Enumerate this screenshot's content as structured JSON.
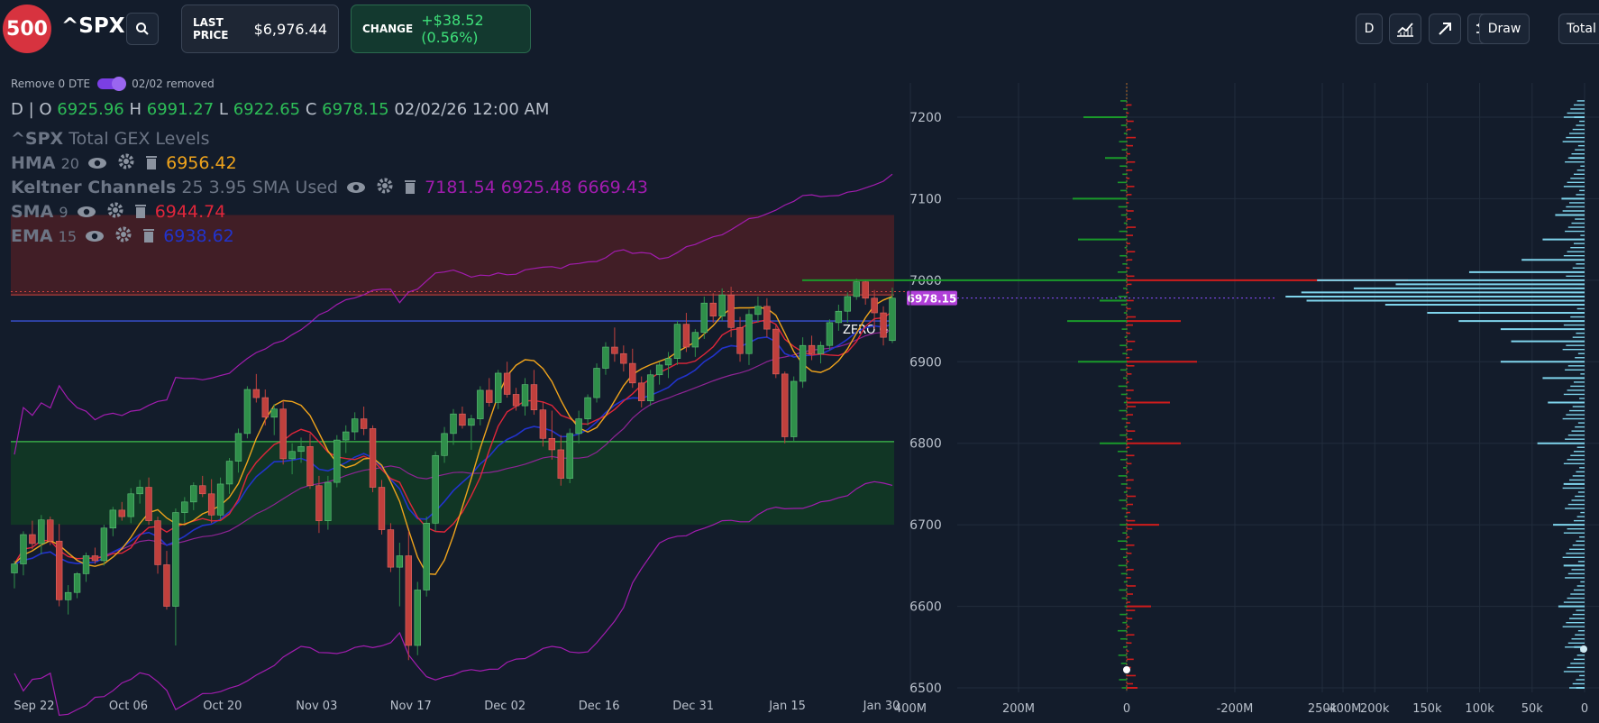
{
  "header": {
    "logo_text": "500",
    "ticker": "^SPX",
    "last_price_label": "LAST PRICE",
    "last_price_value": "$6,976.44",
    "change_label": "CHANGE",
    "change_value": "+$38.52 (0.56%)",
    "interval_button": "D",
    "draw_button": "Draw",
    "total_button": "Total"
  },
  "toolbar_icons": [
    "search-icon",
    "chart-icon",
    "arrow-icon",
    "settings-sliders-icon"
  ],
  "toggle": {
    "label": "Remove 0 DTE",
    "status": "02/02 removed",
    "enabled": true
  },
  "ohlc": {
    "interval": "D |",
    "o_label": "O",
    "o": "6925.96",
    "h_label": "H",
    "h": "6991.27",
    "l_label": "L",
    "l": "6922.65",
    "c_label": "C",
    "c": "6978.15",
    "datetime": "02/02/26 12:00 AM"
  },
  "indicators": {
    "gex": {
      "name": "^SPX",
      "suffix": "Total GEX Levels"
    },
    "hma": {
      "name": "HMA",
      "params": "20",
      "value": "6956.42",
      "color": "#f0a41c"
    },
    "keltner": {
      "name": "Keltner Channels",
      "params": "25 3.95 SMA Used",
      "values": "7181.54 6925.48 6669.43",
      "color": "#a21caf"
    },
    "sma": {
      "name": "SMA",
      "params": "9",
      "value": "6944.74",
      "color": "#e0263a"
    },
    "ema": {
      "name": "EMA",
      "params": "15",
      "value": "6938.62",
      "color": "#2233cc"
    }
  },
  "colors": {
    "up": "#2f8f4a",
    "down": "#c0403d",
    "background": "#131c2b",
    "price_tag": "#b03fd8",
    "zero_gamma_line": "#3a52d8",
    "gex_pos": "#1a9a2a",
    "gex_neg": "#d01c1c",
    "volume": "#7fd4ec"
  },
  "chart_data": [
    {
      "type": "candlestick",
      "y_range": [
        6500,
        7230
      ],
      "x_tick_labels": [
        "Sep 22",
        "Oct 06",
        "Oct 20",
        "Nov 03",
        "Nov 17",
        "Dec 02",
        "Dec 16",
        "Dec 31",
        "Jan 15",
        "Jan 30"
      ],
      "price_tag": "6978.15",
      "annotations": {
        "zero_gamma": {
          "label": "ZERO G",
          "value": 6950
        }
      },
      "zones": [
        {
          "name": "resistance",
          "from": 6982,
          "to": 7080,
          "color": "#4a1e26"
        },
        {
          "name": "support",
          "from": 6700,
          "to": 6802,
          "color": "#123b24"
        }
      ],
      "candles": [
        [
          6641,
          6656,
          6622,
          6652
        ],
        [
          6652,
          6692,
          6638,
          6688
        ],
        [
          6688,
          6705,
          6670,
          6677
        ],
        [
          6677,
          6712,
          6664,
          6706
        ],
        [
          6706,
          6710,
          6675,
          6680
        ],
        [
          6680,
          6701,
          6600,
          6608
        ],
        [
          6608,
          6626,
          6590,
          6617
        ],
        [
          6617,
          6642,
          6610,
          6640
        ],
        [
          6640,
          6666,
          6630,
          6662
        ],
        [
          6662,
          6672,
          6652,
          6656
        ],
        [
          6656,
          6700,
          6650,
          6696
        ],
        [
          6696,
          6722,
          6686,
          6718
        ],
        [
          6718,
          6728,
          6705,
          6710
        ],
        [
          6710,
          6745,
          6702,
          6738
        ],
        [
          6738,
          6755,
          6726,
          6746
        ],
        [
          6746,
          6758,
          6700,
          6705
        ],
        [
          6705,
          6710,
          6640,
          6651
        ],
        [
          6651,
          6668,
          6596,
          6600
        ],
        [
          6600,
          6720,
          6552,
          6715
        ],
        [
          6715,
          6734,
          6702,
          6728
        ],
        [
          6728,
          6752,
          6718,
          6748
        ],
        [
          6748,
          6760,
          6734,
          6738
        ],
        [
          6738,
          6756,
          6702,
          6712
        ],
        [
          6712,
          6758,
          6706,
          6750
        ],
        [
          6750,
          6782,
          6738,
          6778
        ],
        [
          6778,
          6818,
          6764,
          6812
        ],
        [
          6812,
          6870,
          6806,
          6866
        ],
        [
          6866,
          6885,
          6850,
          6856
        ],
        [
          6856,
          6866,
          6822,
          6832
        ],
        [
          6832,
          6848,
          6810,
          6842
        ],
        [
          6842,
          6852,
          6774,
          6781
        ],
        [
          6781,
          6800,
          6762,
          6790
        ],
        [
          6790,
          6807,
          6776,
          6796
        ],
        [
          6796,
          6812,
          6744,
          6748
        ],
        [
          6748,
          6760,
          6690,
          6705
        ],
        [
          6705,
          6760,
          6694,
          6752
        ],
        [
          6752,
          6810,
          6746,
          6804
        ],
        [
          6804,
          6822,
          6788,
          6814
        ],
        [
          6814,
          6838,
          6804,
          6830
        ],
        [
          6830,
          6845,
          6810,
          6818
        ],
        [
          6818,
          6822,
          6740,
          6746
        ],
        [
          6746,
          6755,
          6688,
          6694
        ],
        [
          6694,
          6702,
          6642,
          6648
        ],
        [
          6648,
          6678,
          6600,
          6662
        ],
        [
          6662,
          6692,
          6534,
          6552
        ],
        [
          6552,
          6630,
          6540,
          6620
        ],
        [
          6620,
          6710,
          6612,
          6702
        ],
        [
          6702,
          6790,
          6692,
          6785
        ],
        [
          6785,
          6820,
          6776,
          6812
        ],
        [
          6812,
          6842,
          6798,
          6836
        ],
        [
          6836,
          6845,
          6818,
          6822
        ],
        [
          6822,
          6835,
          6792,
          6830
        ],
        [
          6830,
          6870,
          6822,
          6865
        ],
        [
          6865,
          6880,
          6845,
          6850
        ],
        [
          6850,
          6890,
          6842,
          6886
        ],
        [
          6886,
          6900,
          6856,
          6860
        ],
        [
          6860,
          6868,
          6840,
          6846
        ],
        [
          6846,
          6880,
          6834,
          6872
        ],
        [
          6872,
          6890,
          6835,
          6841
        ],
        [
          6841,
          6850,
          6796,
          6806
        ],
        [
          6806,
          6840,
          6780,
          6792
        ],
        [
          6792,
          6810,
          6748,
          6757
        ],
        [
          6757,
          6818,
          6751,
          6812
        ],
        [
          6812,
          6840,
          6800,
          6830
        ],
        [
          6830,
          6860,
          6822,
          6856
        ],
        [
          6856,
          6898,
          6850,
          6892
        ],
        [
          6892,
          6924,
          6884,
          6918
        ],
        [
          6918,
          6942,
          6900,
          6910
        ],
        [
          6910,
          6920,
          6888,
          6898
        ],
        [
          6898,
          6916,
          6868,
          6874
        ],
        [
          6874,
          6882,
          6844,
          6852
        ],
        [
          6852,
          6890,
          6846,
          6884
        ],
        [
          6884,
          6900,
          6872,
          6896
        ],
        [
          6896,
          6912,
          6880,
          6904
        ],
        [
          6904,
          6950,
          6896,
          6946
        ],
        [
          6946,
          6960,
          6912,
          6918
        ],
        [
          6918,
          6940,
          6906,
          6936
        ],
        [
          6936,
          6980,
          6928,
          6972
        ],
        [
          6972,
          6984,
          6948,
          6956
        ],
        [
          6956,
          6990,
          6950,
          6982
        ],
        [
          6982,
          6992,
          6930,
          6942
        ],
        [
          6942,
          6955,
          6900,
          6910
        ],
        [
          6910,
          6964,
          6896,
          6958
        ],
        [
          6958,
          6980,
          6948,
          6968
        ],
        [
          6968,
          6978,
          6930,
          6940
        ],
        [
          6940,
          6945,
          6880,
          6885
        ],
        [
          6885,
          6888,
          6800,
          6808
        ],
        [
          6808,
          6882,
          6802,
          6876
        ],
        [
          6876,
          6930,
          6868,
          6920
        ],
        [
          6920,
          6932,
          6902,
          6910
        ],
        [
          6910,
          6925,
          6898,
          6920
        ],
        [
          6920,
          6952,
          6914,
          6948
        ],
        [
          6948,
          6970,
          6938,
          6962
        ],
        [
          6962,
          6985,
          6948,
          6980
        ],
        [
          6980,
          7002,
          6976,
          6998
        ],
        [
          6998,
          7000,
          6970,
          6978
        ],
        [
          6978,
          6988,
          6940,
          6960
        ],
        [
          6960,
          6968,
          6920,
          6930
        ],
        [
          6926,
          6991,
          6923,
          6978
        ]
      ]
    },
    {
      "type": "bar",
      "name": "GEX by strike",
      "x_tick_labels": [
        "400M",
        "200M",
        "0",
        "-200M",
        "-400M"
      ],
      "y_tick_labels": [
        "7200",
        "7100",
        "7000",
        "6900",
        "6800",
        "6700",
        "6600",
        "6500"
      ],
      "levels": [
        {
          "strike": 7200,
          "value": 80
        },
        {
          "strike": 7150,
          "value": 40
        },
        {
          "strike": 7100,
          "value": 100
        },
        {
          "strike": 7050,
          "value": 90
        },
        {
          "strike": 7000,
          "value": 600
        },
        {
          "strike": 7000,
          "value": -520
        },
        {
          "strike": 6975,
          "value": 50
        },
        {
          "strike": 6950,
          "value": 110
        },
        {
          "strike": 6950,
          "value": -100
        },
        {
          "strike": 6900,
          "value": 90
        },
        {
          "strike": 6900,
          "value": -130
        },
        {
          "strike": 6850,
          "value": -80
        },
        {
          "strike": 6800,
          "value": 50
        },
        {
          "strike": 6800,
          "value": -100
        },
        {
          "strike": 6700,
          "value": -60
        },
        {
          "strike": 6600,
          "value": -45
        },
        {
          "strike": 6500,
          "value": -20
        }
      ],
      "marker": "0"
    },
    {
      "type": "bar",
      "name": "Total by strike",
      "x_tick_labels": [
        "250k",
        "200k",
        "150k",
        "100k",
        "50k",
        "0"
      ],
      "levels": [
        {
          "strike": 7200,
          "value": 10
        },
        {
          "strike": 7150,
          "value": 14
        },
        {
          "strike": 7100,
          "value": 22
        },
        {
          "strike": 7080,
          "value": 28
        },
        {
          "strike": 7050,
          "value": 40
        },
        {
          "strike": 7025,
          "value": 60
        },
        {
          "strike": 7010,
          "value": 110
        },
        {
          "strike": 7000,
          "value": 255
        },
        {
          "strike": 6995,
          "value": 180
        },
        {
          "strike": 6990,
          "value": 220
        },
        {
          "strike": 6985,
          "value": 270
        },
        {
          "strike": 6980,
          "value": 285
        },
        {
          "strike": 6975,
          "value": 265
        },
        {
          "strike": 6970,
          "value": 190
        },
        {
          "strike": 6960,
          "value": 150
        },
        {
          "strike": 6950,
          "value": 120
        },
        {
          "strike": 6940,
          "value": 80
        },
        {
          "strike": 6925,
          "value": 70
        },
        {
          "strike": 6900,
          "value": 80
        },
        {
          "strike": 6880,
          "value": 40
        },
        {
          "strike": 6850,
          "value": 35
        },
        {
          "strike": 6800,
          "value": 45
        },
        {
          "strike": 6750,
          "value": 20
        },
        {
          "strike": 6700,
          "value": 30
        },
        {
          "strike": 6650,
          "value": 20
        },
        {
          "strike": 6600,
          "value": 25
        },
        {
          "strike": 6550,
          "value": 10
        },
        {
          "strike": 6500,
          "value": 8
        }
      ]
    }
  ]
}
